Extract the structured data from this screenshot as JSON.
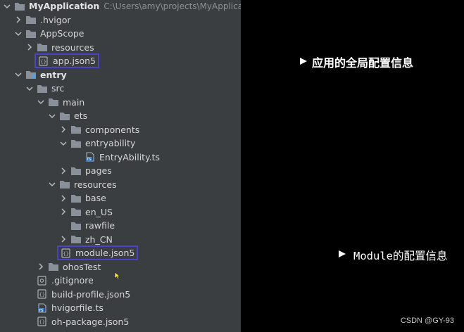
{
  "tree": {
    "root": {
      "name": "MyApplication",
      "path": "C:\\Users\\amy\\projects\\MyApplication"
    },
    "items": [
      {
        "name": ".hvigor",
        "type": "folder",
        "state": "collapsed"
      },
      {
        "name": "AppScope",
        "type": "folder",
        "state": "expanded"
      },
      {
        "name": "resources",
        "type": "folder",
        "state": "collapsed"
      },
      {
        "name": "app.json5",
        "type": "json5",
        "highlighted": true
      },
      {
        "name": "entry",
        "type": "module-folder",
        "state": "expanded"
      },
      {
        "name": "src",
        "type": "folder",
        "state": "expanded"
      },
      {
        "name": "main",
        "type": "folder",
        "state": "expanded"
      },
      {
        "name": "ets",
        "type": "folder",
        "state": "expanded"
      },
      {
        "name": "components",
        "type": "folder",
        "state": "collapsed"
      },
      {
        "name": "entryability",
        "type": "folder",
        "state": "expanded"
      },
      {
        "name": "EntryAbility.ts",
        "type": "ts"
      },
      {
        "name": "pages",
        "type": "folder",
        "state": "collapsed"
      },
      {
        "name": "resources",
        "type": "folder",
        "state": "expanded"
      },
      {
        "name": "base",
        "type": "folder",
        "state": "collapsed"
      },
      {
        "name": "en_US",
        "type": "folder",
        "state": "collapsed"
      },
      {
        "name": "rawfile",
        "type": "folder",
        "state": "none"
      },
      {
        "name": "zh_CN",
        "type": "folder",
        "state": "collapsed"
      },
      {
        "name": "module.json5",
        "type": "json5",
        "highlighted": true
      },
      {
        "name": "ohosTest",
        "type": "folder",
        "state": "collapsed"
      },
      {
        "name": ".gitignore",
        "type": "config"
      },
      {
        "name": "build-profile.json5",
        "type": "json5"
      },
      {
        "name": "hvigorfile.ts",
        "type": "ts"
      },
      {
        "name": "oh-package.json5",
        "type": "json5"
      }
    ]
  },
  "annotations": {
    "app_config": "应用的全局配置信息",
    "module_config": "Module的配置信息"
  },
  "credit": "CSDN @GY-93",
  "colors": {
    "panel_bg": "#3b3e40",
    "right_bg": "#000000",
    "highlight": "#4b44c9",
    "folder": "#8a9099",
    "text": "#d4d6d8"
  }
}
